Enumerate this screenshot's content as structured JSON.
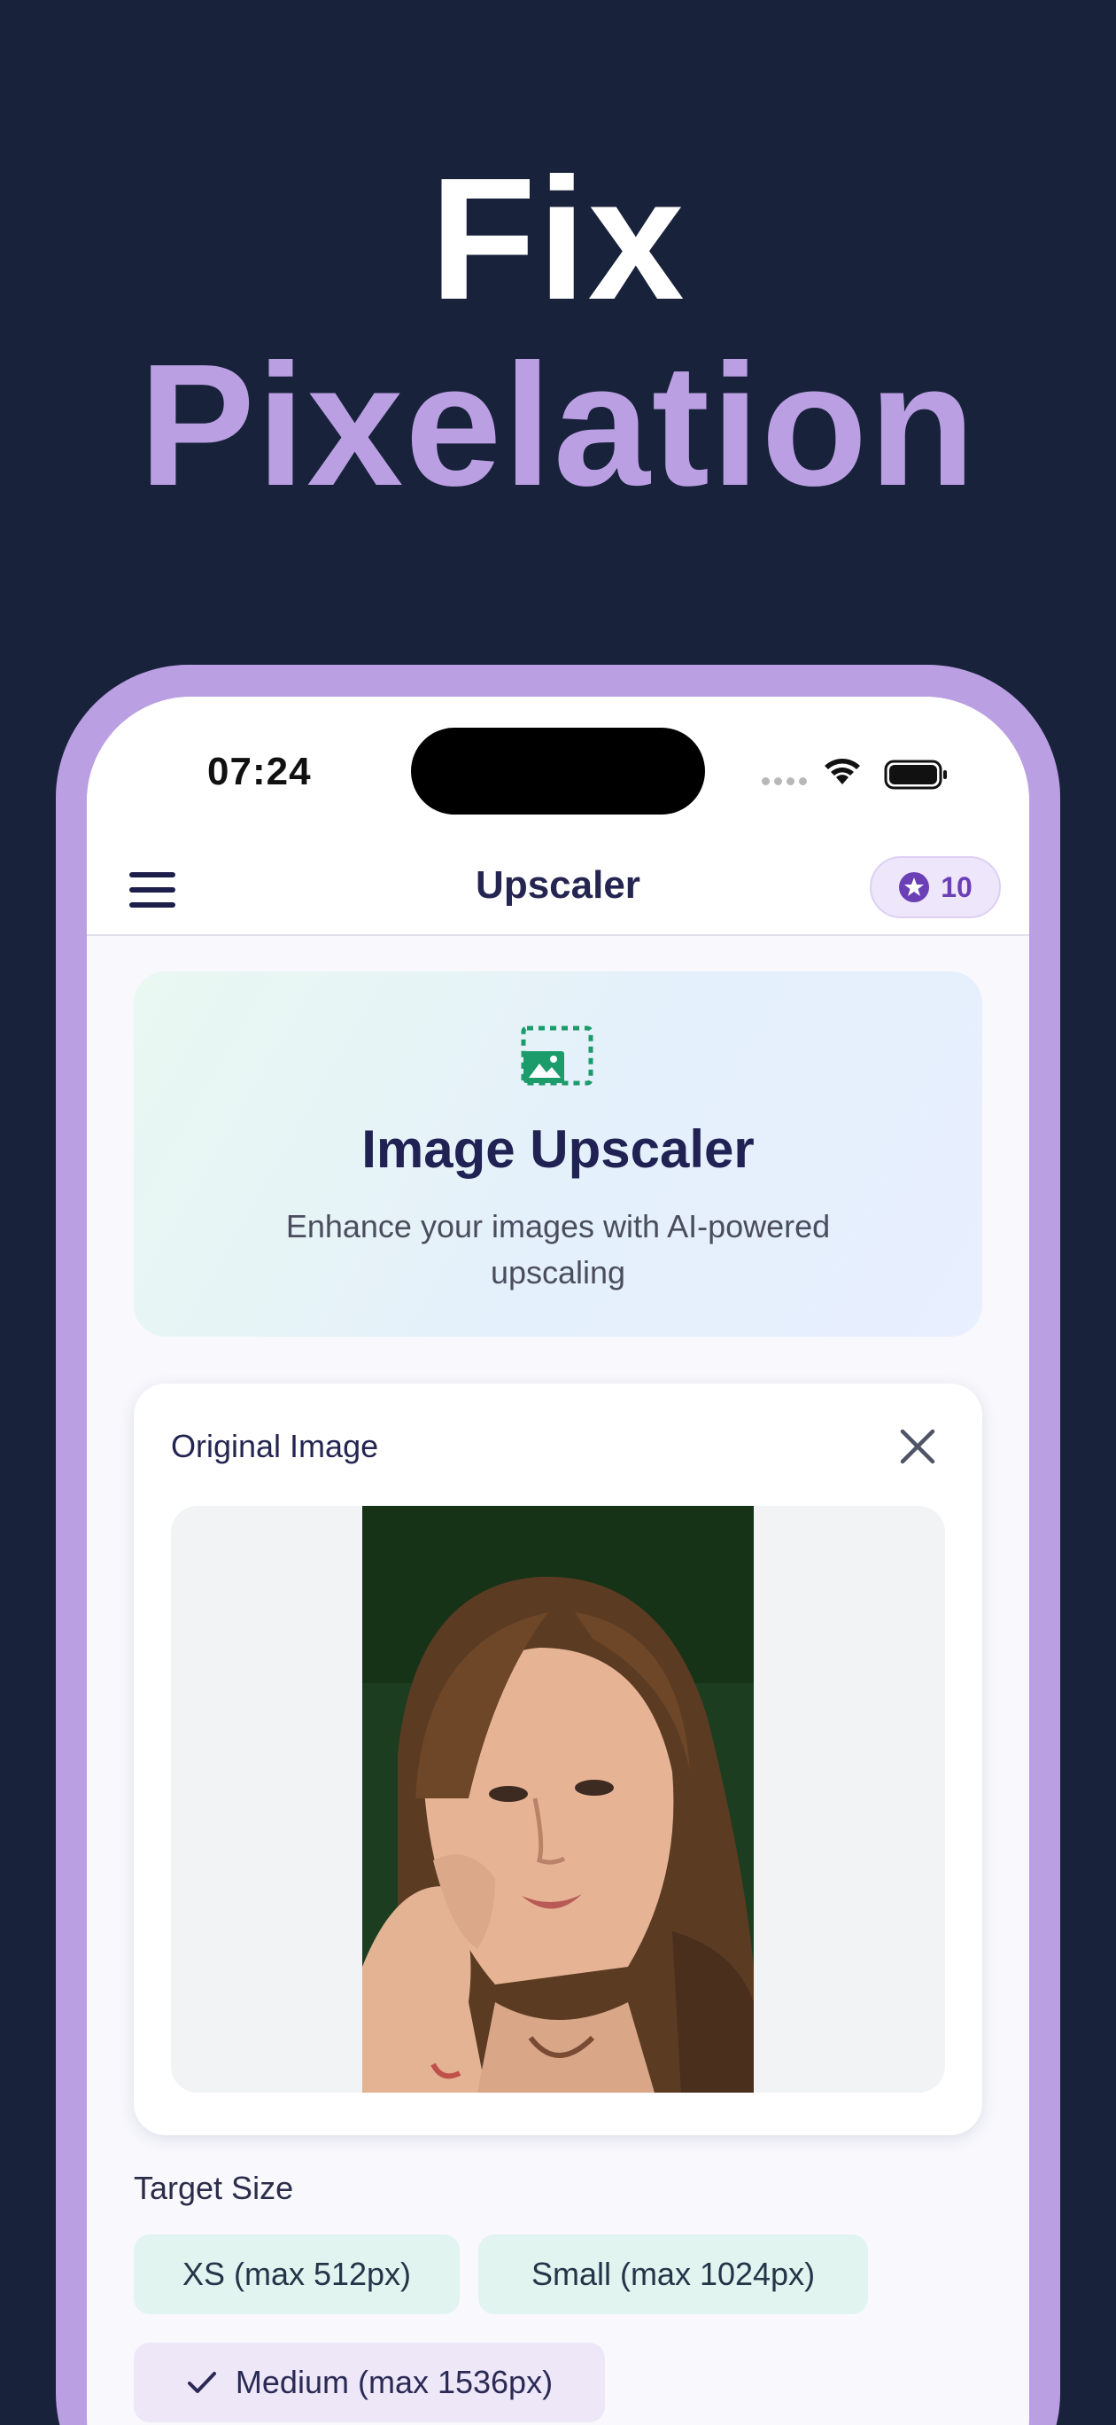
{
  "hero": {
    "line1": "Fix",
    "line2": "Pixelation"
  },
  "status_bar": {
    "time": "07:24"
  },
  "app_bar": {
    "title": "Upscaler",
    "credits": "10",
    "credits_icon": "star-icon",
    "menu_icon": "hamburger-menu-icon"
  },
  "banner": {
    "icon": "image-upscale-icon",
    "title": "Image Upscaler",
    "subtitle": "Enhance your images with AI-powered upscaling"
  },
  "image_card": {
    "title": "Original Image",
    "close_icon": "close-icon"
  },
  "target_size": {
    "label": "Target Size",
    "options": [
      {
        "label": "XS (max 512px)",
        "selected": false
      },
      {
        "label": "Small (max 1024px)",
        "selected": false
      },
      {
        "label": "Medium (max 1536px)",
        "selected": true
      }
    ]
  },
  "colors": {
    "background": "#18223b",
    "accent": "#bb9fe3",
    "chip_green": "#e2f4ef",
    "chip_selected": "#ede7f8",
    "icon_green": "#1c9b6b"
  }
}
